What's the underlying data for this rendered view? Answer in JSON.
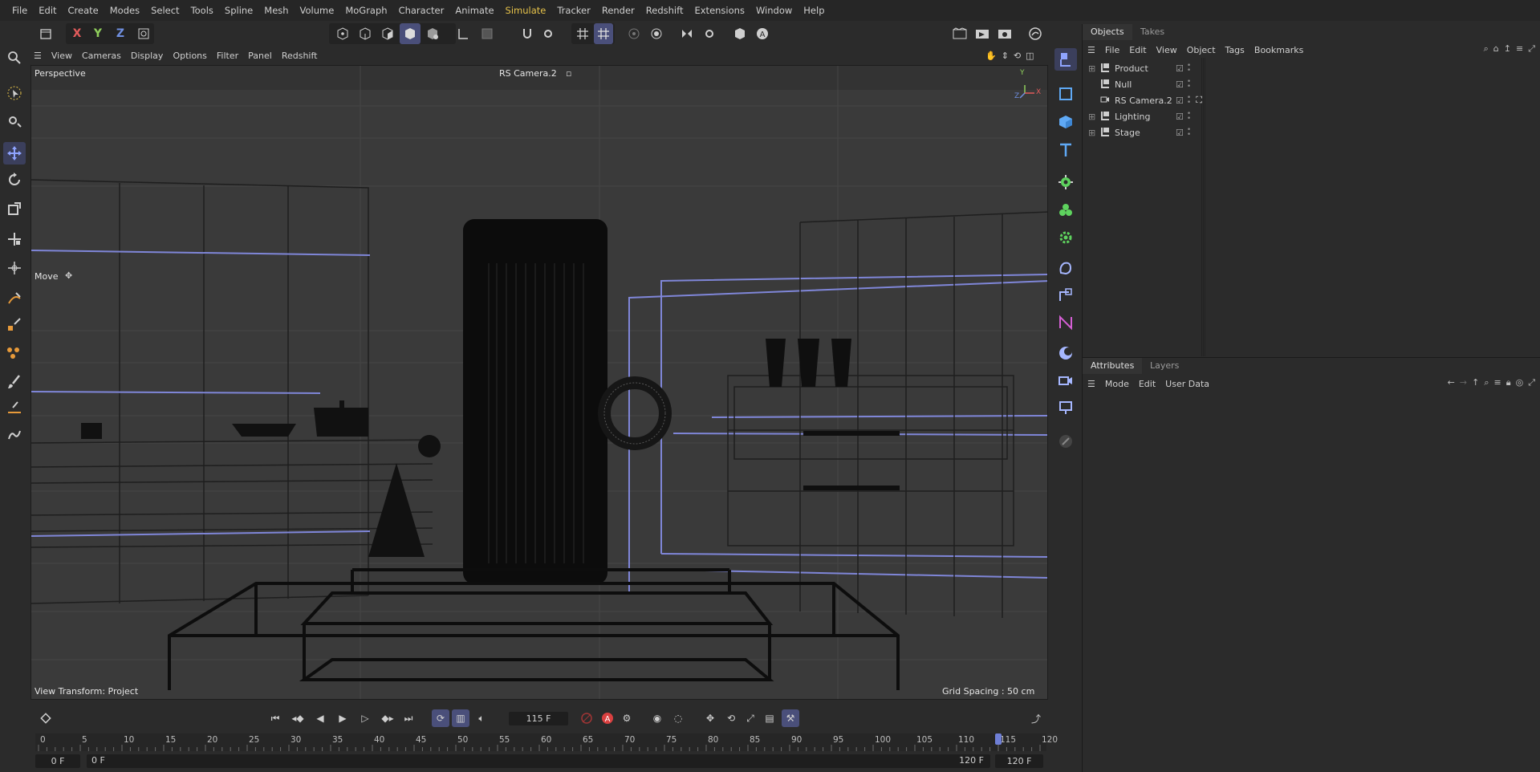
{
  "menubar": {
    "items": [
      "File",
      "Edit",
      "Create",
      "Modes",
      "Select",
      "Tools",
      "Spline",
      "Mesh",
      "Volume",
      "MoGraph",
      "Character",
      "Animate",
      "Simulate",
      "Tracker",
      "Render",
      "Redshift",
      "Extensions",
      "Window",
      "Help"
    ],
    "highlighted": "Simulate"
  },
  "toolbar": {
    "axis_x": "X",
    "axis_y": "Y",
    "axis_z": "Z"
  },
  "viewport_menu": {
    "items": [
      "View",
      "Cameras",
      "Display",
      "Options",
      "Filter",
      "Panel",
      "Redshift"
    ]
  },
  "viewport": {
    "view_name": "Perspective",
    "camera_name": "RS Camera.2",
    "tool_hint": "Move",
    "view_transform": "View Transform: Project",
    "grid_spacing": "Grid Spacing : 50 cm",
    "axis_y": "Y",
    "axis_z": "Z",
    "axis_x": "X"
  },
  "objects_panel": {
    "tabs": [
      "Objects",
      "Takes"
    ],
    "menu": [
      "File",
      "Edit",
      "View",
      "Object",
      "Tags",
      "Bookmarks"
    ],
    "items": [
      {
        "name": "Product",
        "expandable": true
      },
      {
        "name": "Null",
        "expandable": false
      },
      {
        "name": "RS Camera.2",
        "expandable": false
      },
      {
        "name": "Lighting",
        "expandable": true
      },
      {
        "name": "Stage",
        "expandable": true
      }
    ]
  },
  "attributes_panel": {
    "tabs": [
      "Attributes",
      "Layers"
    ],
    "menu": [
      "Mode",
      "Edit",
      "User Data"
    ]
  },
  "timeline": {
    "current_frame": "115 F",
    "start_field": "0 F",
    "start_field2": "0 F",
    "end_field": "120 F",
    "end_field2": "120 F",
    "ruler_labels": [
      "0",
      "5",
      "10",
      "15",
      "20",
      "25",
      "30",
      "35",
      "40",
      "45",
      "50",
      "55",
      "60",
      "65",
      "70",
      "75",
      "80",
      "85",
      "90",
      "95",
      "100",
      "105",
      "110",
      "115",
      "120"
    ],
    "playhead_frame": 115
  },
  "colors": {
    "accent": "#6f7fd6",
    "active_menu": "#e7c34a",
    "record": "#d94040"
  }
}
